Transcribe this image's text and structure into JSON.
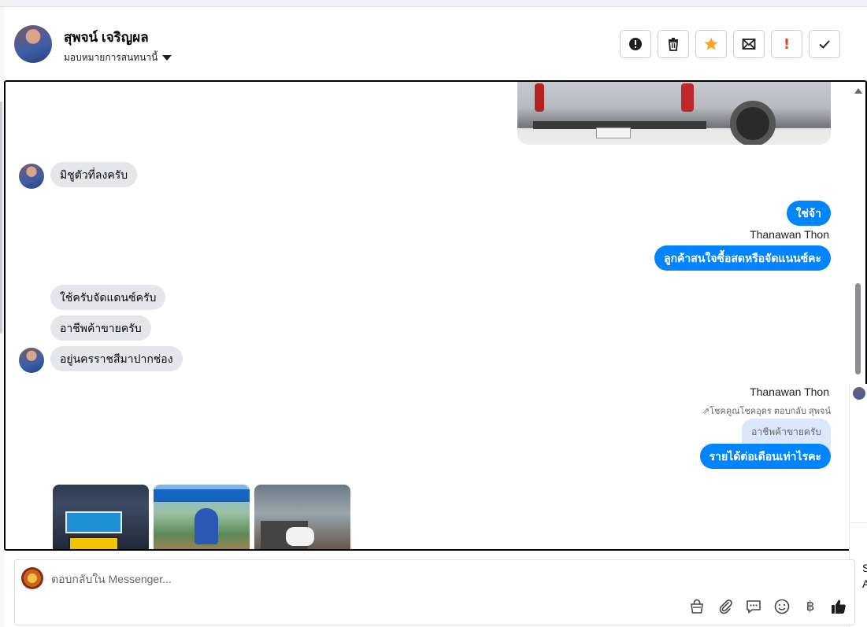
{
  "header": {
    "contact_name": "สุพจน์ เจริญผล",
    "assign_label": "มอบหมายการสนทนานี้",
    "toolbar": [
      {
        "name": "report-spam-button",
        "icon": "alert-circle-icon"
      },
      {
        "name": "delete-button",
        "icon": "trash-icon"
      },
      {
        "name": "star-button",
        "icon": "star-icon",
        "color": "#f5a623"
      },
      {
        "name": "mark-unread-button",
        "icon": "envelope-icon"
      },
      {
        "name": "mark-important-button",
        "icon": "exclamation-icon",
        "color": "#e0471a",
        "glyph": "!"
      },
      {
        "name": "mark-done-button",
        "icon": "check-icon"
      }
    ]
  },
  "messages": [
    {
      "direction": "in",
      "text": "มิชูตัวที่ลงครับ"
    },
    {
      "direction": "out",
      "text": "ใช่จ้า"
    },
    {
      "direction": "out",
      "sender": "Thanawan Thon",
      "text": "ลูกค้าสนใจซื้อสดหรือจัดแนนซ์คะ"
    },
    {
      "direction": "in",
      "text": "ใช้ครับจัดแดนซ์ครับ"
    },
    {
      "direction": "in",
      "text": "อาชีพค้าขายครับ"
    },
    {
      "direction": "in",
      "text": "อยู่นครราชสีมาปากช่อง"
    },
    {
      "direction": "out",
      "sender": "Thanawan Thon",
      "reply_note": "โชคคูณโชคอุดร ตอบกลับ สุพจน์",
      "quoted": "อาชีพค้าขายครับ",
      "text": "รายได้ต่อเดือนเท่าไรคะ"
    }
  ],
  "side_fragment": {
    "char1": "S",
    "char2": "A"
  },
  "composer": {
    "placeholder": "ตอบกลับใน Messenger...",
    "tools": [
      "bag-icon",
      "paperclip-icon",
      "chat-bubble-icon",
      "emoji-icon",
      "baht-icon",
      "thumbs-up-icon"
    ],
    "baht_glyph": "฿"
  }
}
